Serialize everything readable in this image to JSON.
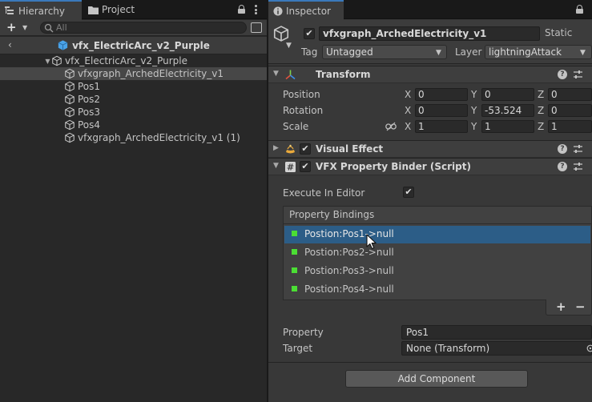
{
  "left": {
    "tabs": [
      {
        "label": "Hierarchy",
        "icon": "hierarchy-icon",
        "active": true
      },
      {
        "label": "Project",
        "icon": "folder-icon",
        "active": false
      }
    ],
    "search_placeholder": "All",
    "scene_title": "vfx_ElectricArc_v2_Purple",
    "tree": [
      {
        "label": "vfx_ElectricArc_v2_Purple",
        "depth": 0,
        "expanded": true,
        "selected": false
      },
      {
        "label": "vfxgraph_ArchedElectricity_v1",
        "depth": 1,
        "selected": true
      },
      {
        "label": "Pos1",
        "depth": 1,
        "selected": false
      },
      {
        "label": "Pos2",
        "depth": 1,
        "selected": false
      },
      {
        "label": "Pos3",
        "depth": 1,
        "selected": false
      },
      {
        "label": "Pos4",
        "depth": 1,
        "selected": false
      },
      {
        "label": "vfxgraph_ArchedElectricity_v1 (1)",
        "depth": 1,
        "selected": false
      }
    ]
  },
  "inspector": {
    "tab_label": "Inspector",
    "object_name": "vfxgraph_ArchedElectricity_v1",
    "active": true,
    "static_label": "Static",
    "tag_label": "Tag",
    "tag_value": "Untagged",
    "layer_label": "Layer",
    "layer_value": "lightningAttack",
    "transform": {
      "title": "Transform",
      "position_label": "Position",
      "rotation_label": "Rotation",
      "scale_label": "Scale",
      "axis_x": "X",
      "axis_y": "Y",
      "axis_z": "Z",
      "position": {
        "x": "0",
        "y": "0",
        "z": "0"
      },
      "rotation": {
        "x": "0",
        "y": "-53.524",
        "z": "0"
      },
      "scale": {
        "x": "1",
        "y": "1",
        "z": "1"
      }
    },
    "visual_effect": {
      "title": "Visual Effect",
      "enabled": true
    },
    "property_binder": {
      "title": "VFX Property Binder (Script)",
      "enabled": true,
      "execute_label": "Execute In Editor",
      "execute_checked": true,
      "bindings_header": "Property Bindings",
      "bindings": [
        {
          "label": "Postion:Pos1->null",
          "selected": true
        },
        {
          "label": "Postion:Pos2->null",
          "selected": false
        },
        {
          "label": "Postion:Pos3->null",
          "selected": false
        },
        {
          "label": "Postion:Pos4->null",
          "selected": false
        }
      ],
      "add_symbol": "+",
      "remove_symbol": "−",
      "property_label": "Property",
      "property_value": "Pos1",
      "target_label": "Target",
      "target_value": "None (Transform)"
    },
    "add_component_label": "Add Component"
  },
  "colors": {
    "accent": "#3a79bb",
    "selection": "#2c5d87",
    "binding_marker": "#4bde34",
    "panel_bg": "#383838",
    "hierarchy_bg": "#282828"
  }
}
